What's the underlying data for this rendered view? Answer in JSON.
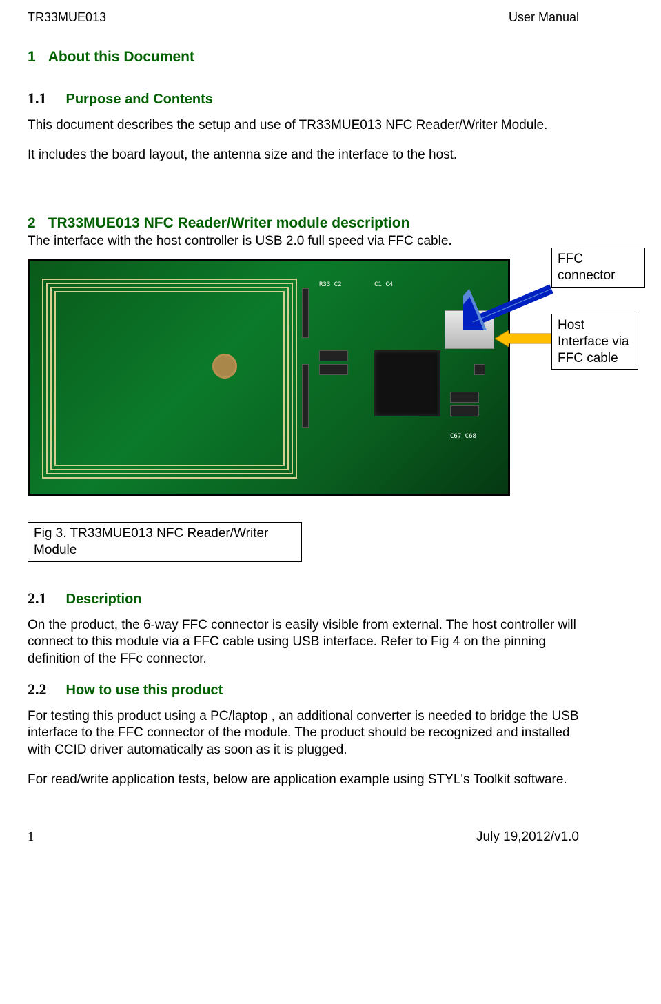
{
  "header": {
    "left": "TR33MUE013",
    "right": "User Manual"
  },
  "sec1": {
    "num": "1",
    "title": "About this Document"
  },
  "sec1_1": {
    "num": "1.1",
    "title": "Purpose and Contents",
    "p1": "This document describes the setup and use of TR33MUE013 NFC Reader/Writer Module.",
    "p2": "It includes the board layout, the antenna size and the interface to the host."
  },
  "sec2": {
    "num": "2",
    "title": "TR33MUE013 NFC Reader/Writer module description",
    "intro": "The interface with the host controller is USB 2.0 full speed via FFC cable."
  },
  "callouts": {
    "ffc": "FFC connector",
    "host": "Host Interface via FFC cable"
  },
  "fig_caption": "Fig 3. TR33MUE013 NFC Reader/Writer Module",
  "sec2_1": {
    "num": "2.1",
    "title": "Description",
    "p1": "On the product, the 6-way FFC connector is easily visible from external. The host controller will connect to this module via a FFC cable using USB interface. Refer to  Fig 4 on the pinning definition of the FFc connector."
  },
  "sec2_2": {
    "num": "2.2",
    "title": "How to use this product",
    "p1": "For testing this product using a PC/laptop , an additional converter is needed to bridge the USB interface to the FFC connector of the module.  The product should be recognized and installed with CCID driver automatically as soon as it is plugged.",
    "p2": "For read/write application tests, below are application example using STYL's  Toolkit software."
  },
  "footer": {
    "page": "1",
    "date": "July 19,2012/v1.0"
  }
}
